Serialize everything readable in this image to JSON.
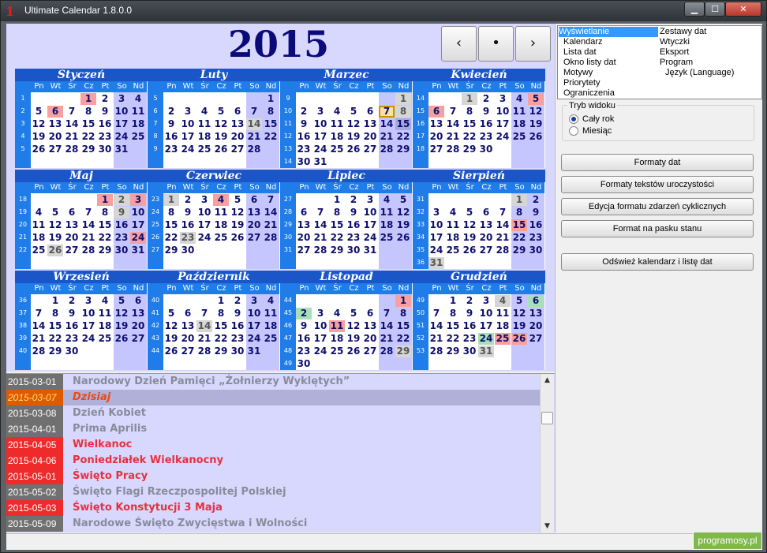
{
  "window": {
    "title": "Ultimate Calendar 1.8.0.0",
    "icon": "app-logo-icon",
    "controls": {
      "minimize": "▁",
      "maximize": "☐",
      "close": "✕"
    }
  },
  "header": {
    "year": "2015",
    "prev_label": "‹",
    "today_label": "•",
    "next_label": "›"
  },
  "weekday_headers": [
    "Pn",
    "Wt",
    "Śr",
    "Cz",
    "Pt",
    "So",
    "Nd"
  ],
  "months": [
    {
      "name": "Styczeń",
      "weeks": [
        "1",
        "2",
        "3",
        "4",
        "5"
      ],
      "first_dow": 3,
      "days": 31,
      "marks": {
        "1": "red",
        "6": "red"
      }
    },
    {
      "name": "Luty",
      "weeks": [
        "5",
        "6",
        "7",
        "8",
        "9"
      ],
      "first_dow": 6,
      "days": 28,
      "marks": {
        "14": "gray"
      }
    },
    {
      "name": "Marzec",
      "weeks": [
        "9",
        "10",
        "11",
        "12",
        "13",
        "14"
      ],
      "first_dow": 6,
      "days": 31,
      "marks": {
        "1": "gray",
        "7": "today",
        "8": "gray",
        "15": "hatch"
      }
    },
    {
      "name": "Kwiecień",
      "weeks": [
        "14",
        "15",
        "16",
        "17",
        "18"
      ],
      "first_dow": 2,
      "days": 30,
      "marks": {
        "1": "gray",
        "5": "red",
        "6": "red"
      }
    },
    {
      "name": "Maj",
      "weeks": [
        "18",
        "19",
        "20",
        "21",
        "22"
      ],
      "first_dow": 4,
      "days": 31,
      "marks": {
        "1": "red",
        "2": "gray",
        "3": "red",
        "9": "gray",
        "24": "red",
        "26": "gray"
      }
    },
    {
      "name": "Czerwiec",
      "weeks": [
        "23",
        "24",
        "25",
        "26",
        "27"
      ],
      "first_dow": 0,
      "days": 30,
      "marks": {
        "1": "gray",
        "4": "red",
        "23": "gray"
      }
    },
    {
      "name": "Lipiec",
      "weeks": [
        "27",
        "28",
        "29",
        "30",
        "31"
      ],
      "first_dow": 2,
      "days": 31,
      "marks": {}
    },
    {
      "name": "Sierpień",
      "weeks": [
        "31",
        "32",
        "33",
        "34",
        "35",
        "36"
      ],
      "first_dow": 5,
      "days": 31,
      "marks": {
        "1": "gray",
        "15": "red",
        "31": "gray"
      }
    },
    {
      "name": "Wrzesień",
      "weeks": [
        "36",
        "37",
        "38",
        "39",
        "40"
      ],
      "first_dow": 1,
      "days": 30,
      "marks": {}
    },
    {
      "name": "Październik",
      "weeks": [
        "40",
        "41",
        "42",
        "43",
        "44"
      ],
      "first_dow": 3,
      "days": 31,
      "marks": {
        "14": "gray"
      }
    },
    {
      "name": "Listopad",
      "weeks": [
        "44",
        "45",
        "46",
        "47",
        "48",
        "49"
      ],
      "first_dow": 6,
      "days": 30,
      "marks": {
        "1": "red",
        "2": "green",
        "11": "red",
        "29": "gray"
      }
    },
    {
      "name": "Grudzień",
      "weeks": [
        "49",
        "50",
        "51",
        "52",
        "53"
      ],
      "first_dow": 1,
      "days": 31,
      "marks": {
        "4": "gray",
        "6": "green",
        "24": "green",
        "25": "red",
        "26": "red",
        "31": "gray"
      }
    }
  ],
  "events": [
    {
      "date": "2015-03-01",
      "text": "Narodowy Dzień Pamięci „Żołnierzy Wyklętych”",
      "kind": "gray"
    },
    {
      "date": "2015-03-07",
      "text": "Dzisiaj",
      "kind": "today"
    },
    {
      "date": "2015-03-08",
      "text": "Dzień Kobiet",
      "kind": "gray"
    },
    {
      "date": "2015-04-01",
      "text": "Prima Aprilis",
      "kind": "gray"
    },
    {
      "date": "2015-04-05",
      "text": "Wielkanoc",
      "kind": "red"
    },
    {
      "date": "2015-04-06",
      "text": "Poniedziałek Wielkanocny",
      "kind": "red"
    },
    {
      "date": "2015-05-01",
      "text": "Święto Pracy",
      "kind": "red"
    },
    {
      "date": "2015-05-02",
      "text": "Święto Flagi Rzeczpospolitej Polskiej",
      "kind": "gray"
    },
    {
      "date": "2015-05-03",
      "text": "Święto Konstytucji 3 Maja",
      "kind": "red"
    },
    {
      "date": "2015-05-09",
      "text": "Narodowe Święto Zwycięstwa i Wolności",
      "kind": "gray"
    }
  ],
  "settings_menu": {
    "col1": [
      "Wyświetlanie",
      "Kalendarz",
      "Lista dat",
      "Okno listy dat",
      "Motywy",
      "Priorytety",
      "Ograniczenia"
    ],
    "col2": [
      "Zestawy dat",
      "Wtyczki",
      "Eksport",
      "Program",
      "Język (Language)"
    ],
    "selected": "Wyświetlanie"
  },
  "view_mode": {
    "legend": "Tryb widoku",
    "options": [
      "Cały rok",
      "Miesiąc"
    ],
    "selected": "Cały rok"
  },
  "buttons": {
    "date_formats": "Formaty dat",
    "celebration_formats": "Formaty tekstów uroczystości",
    "cyclic_format": "Edycja formatu zdarzeń cyklicznych",
    "statusbar_format": "Format na pasku stanu",
    "refresh": "Odśwież kalendarz i listę dat"
  },
  "watermark": "programosy.pl",
  "colors": {
    "month_header": "#1a56c8",
    "day_header": "#1f7ce8",
    "day_text": "#0d0d6e",
    "weekend_bg": "#c6c6ff",
    "holiday": "#f8a0a0",
    "event_red_text": "#e8303c",
    "event_gray_text": "#8a8a9a",
    "event_date_red_bg": "#ee2a2a",
    "event_date_gray_bg": "#707070"
  }
}
